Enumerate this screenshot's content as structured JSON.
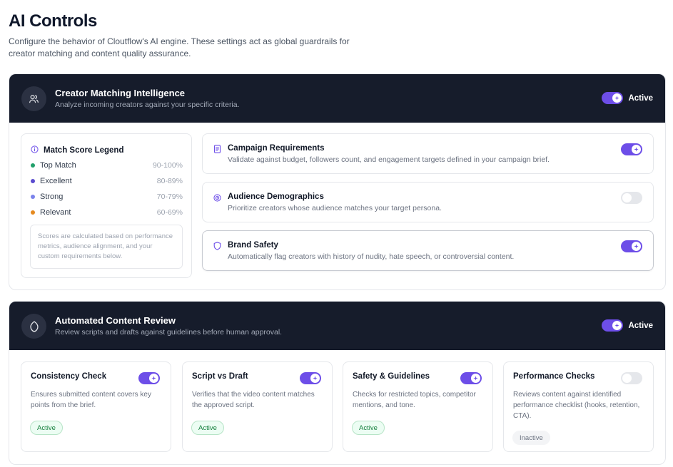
{
  "page": {
    "title": "AI Controls",
    "description": "Configure the behavior of Cloutflow's AI engine. These settings act as global guardrails for creator matching and content quality assurance."
  },
  "colors": {
    "header_bg": "#161c2b",
    "accent": "#6d4ee8",
    "active_green": "#15803d"
  },
  "matching": {
    "icon": "users-icon",
    "title": "Creator Matching Intelligence",
    "subtitle": "Analyze incoming creators against your specific criteria.",
    "toggle_on": true,
    "toggle_label": "Active",
    "legend": {
      "icon": "info-icon",
      "title": "Match Score Legend",
      "items": [
        {
          "name": "Top Match",
          "range": "90-100%",
          "color": "#22a06b"
        },
        {
          "name": "Excellent",
          "range": "80-89%",
          "color": "#5b4ccf"
        },
        {
          "name": "Strong",
          "range": "70-79%",
          "color": "#7b83eb"
        },
        {
          "name": "Relevant",
          "range": "60-69%",
          "color": "#e58a1f"
        }
      ],
      "note": "Scores are calculated based on performance metrics, audience alignment, and your custom requirements below."
    },
    "criteria": [
      {
        "icon": "document-icon",
        "title": "Campaign Requirements",
        "desc": "Validate against budget, followers count, and engagement targets defined in your campaign brief.",
        "on": true
      },
      {
        "icon": "target-icon",
        "title": "Audience Demographics",
        "desc": "Prioritize creators whose audience matches your target persona.",
        "on": false
      },
      {
        "icon": "shield-icon",
        "title": "Brand Safety",
        "desc": "Automatically flag creators with history of nudity, hate speech, or controversial content.",
        "on": true
      }
    ]
  },
  "review": {
    "icon": "leaf-icon",
    "title": "Automated Content Review",
    "subtitle": "Review scripts and drafts against guidelines before human approval.",
    "toggle_on": true,
    "toggle_label": "Active",
    "cards": [
      {
        "title": "Consistency Check",
        "desc": "Ensures submitted content covers key points from the brief.",
        "status": "Active",
        "on": true
      },
      {
        "title": "Script vs Draft",
        "desc": "Verifies that the video content matches the approved script.",
        "status": "Active",
        "on": true
      },
      {
        "title": "Safety & Guidelines",
        "desc": "Checks for restricted topics, competitor mentions, and tone.",
        "status": "Active",
        "on": true
      },
      {
        "title": "Performance Checks",
        "desc": "Reviews content against identified performance checklist (hooks, retention, CTA).",
        "status": "Inactive",
        "on": false
      }
    ]
  }
}
